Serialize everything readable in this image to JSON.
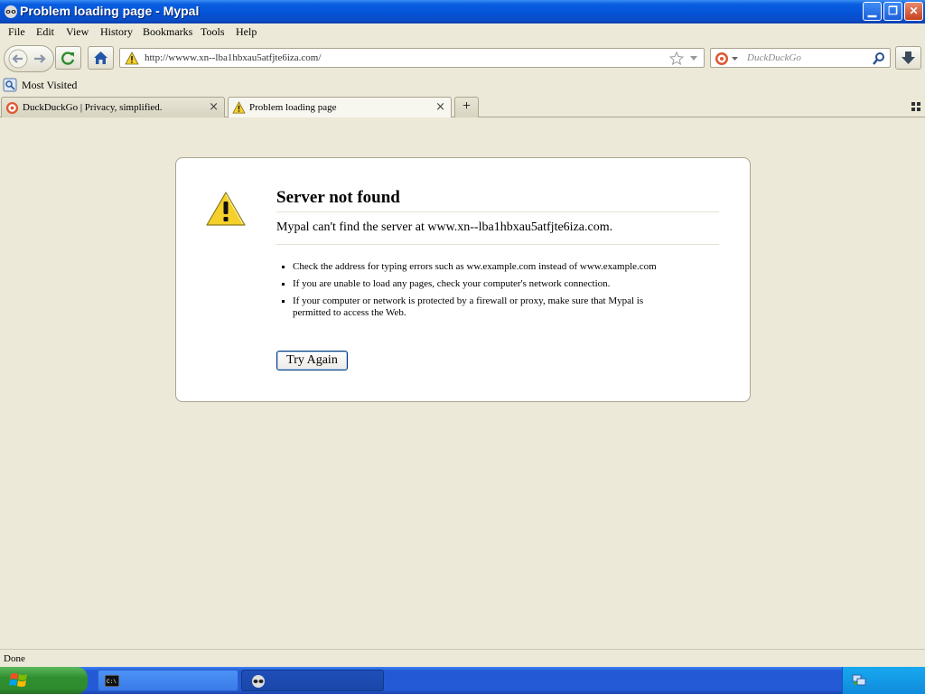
{
  "window": {
    "title": "Problem loading page - Mypal",
    "minimize_glyph": "▁",
    "maximize_glyph": "❐",
    "close_glyph": "✕"
  },
  "menu": [
    "File",
    "Edit",
    "View",
    "History",
    "Bookmarks",
    "Tools",
    "Help"
  ],
  "navbar": {
    "url": "http://wwww.xn--lba1hbxau5atfjte6iza.com/",
    "search_placeholder": "DuckDuckGo"
  },
  "bookmarks": {
    "most_visited": "Most Visited"
  },
  "tabs": [
    {
      "label": "DuckDuckGo | Privacy, simplified.",
      "active": false
    },
    {
      "label": "Problem loading page",
      "active": true
    }
  ],
  "newtab_label": "+",
  "error": {
    "title": "Server not found",
    "short_desc": "Mypal can't find the server at www.xn--lba1hbxau5atfjte6iza.com.",
    "suggestions": [
      "Check the address for typing errors such as ww.example.com instead of www.example.com",
      "If you are unable to load any pages, check your computer's network connection.",
      "If your computer or network is protected by a firewall or proxy, make sure that Mypal is permitted to access the Web."
    ],
    "try_again": "Try Again"
  },
  "status": "Done",
  "taskbar": {
    "items": [
      {
        "icon": "console-icon",
        "label": ""
      },
      {
        "icon": "mypal-icon",
        "label": ""
      }
    ]
  },
  "colors": {
    "titlebar": "#0453d7",
    "chrome_bg": "#ece9d8",
    "warning_yellow": "#f5d02b"
  }
}
